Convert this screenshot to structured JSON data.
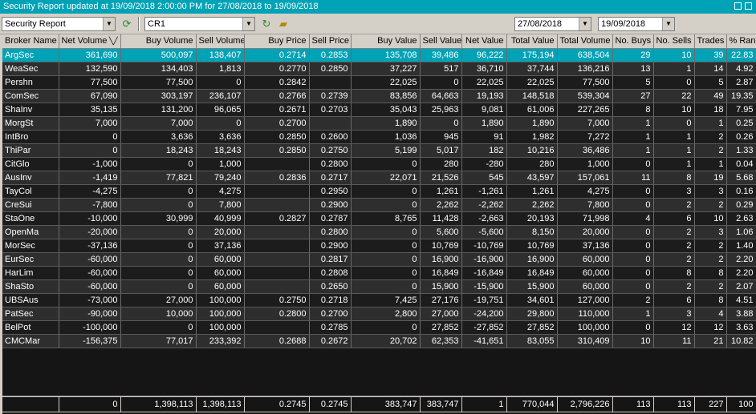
{
  "window": {
    "title": "Security Report updated at 19/09/2018 2:00:00 PM for 27/08/2018 to 19/09/2018"
  },
  "toolbar": {
    "report_select": "Security Report",
    "code_select": "CR1",
    "date_from": "27/08/2018",
    "date_to": "19/09/2018"
  },
  "grid": {
    "columns": [
      "Broker Name",
      "Net Volume",
      "Buy Volume",
      "Sell Volume",
      "Buy Price",
      "Sell Price",
      "Buy Value",
      "Sell Value",
      "Net Value",
      "Total Value",
      "Total Volume",
      "No. Buys",
      "No. Sells",
      "Trades",
      "% Rank"
    ],
    "sort_indicator": "╲╱",
    "rows": [
      [
        "ArgSec",
        "361,690",
        "500,097",
        "138,407",
        "0.2714",
        "0.2853",
        "135,708",
        "39,486",
        "96,222",
        "175,194",
        "638,504",
        "29",
        "10",
        "39",
        "22.83"
      ],
      [
        "WeaSec",
        "132,590",
        "134,403",
        "1,813",
        "0.2770",
        "0.2850",
        "37,227",
        "517",
        "36,710",
        "37,744",
        "136,216",
        "13",
        "1",
        "14",
        "4.92"
      ],
      [
        "Pershn",
        "77,500",
        "77,500",
        "0",
        "0.2842",
        "",
        "22,025",
        "0",
        "22,025",
        "22,025",
        "77,500",
        "5",
        "0",
        "5",
        "2.87"
      ],
      [
        "ComSec",
        "67,090",
        "303,197",
        "236,107",
        "0.2766",
        "0.2739",
        "83,856",
        "64,663",
        "19,193",
        "148,518",
        "539,304",
        "27",
        "22",
        "49",
        "19.35"
      ],
      [
        "ShaInv",
        "35,135",
        "131,200",
        "96,065",
        "0.2671",
        "0.2703",
        "35,043",
        "25,963",
        "9,081",
        "61,006",
        "227,265",
        "8",
        "10",
        "18",
        "7.95"
      ],
      [
        "MorgSt",
        "7,000",
        "7,000",
        "0",
        "0.2700",
        "",
        "1,890",
        "0",
        "1,890",
        "1,890",
        "7,000",
        "1",
        "0",
        "1",
        "0.25"
      ],
      [
        "IntBro",
        "0",
        "3,636",
        "3,636",
        "0.2850",
        "0.2600",
        "1,036",
        "945",
        "91",
        "1,982",
        "7,272",
        "1",
        "1",
        "2",
        "0.26"
      ],
      [
        "ThiPar",
        "0",
        "18,243",
        "18,243",
        "0.2850",
        "0.2750",
        "5,199",
        "5,017",
        "182",
        "10,216",
        "36,486",
        "1",
        "1",
        "2",
        "1.33"
      ],
      [
        "CitGlo",
        "-1,000",
        "0",
        "1,000",
        "",
        "0.2800",
        "0",
        "280",
        "-280",
        "280",
        "1,000",
        "0",
        "1",
        "1",
        "0.04"
      ],
      [
        "AusInv",
        "-1,419",
        "77,821",
        "79,240",
        "0.2836",
        "0.2717",
        "22,071",
        "21,526",
        "545",
        "43,597",
        "157,061",
        "11",
        "8",
        "19",
        "5.68"
      ],
      [
        "TayCol",
        "-4,275",
        "0",
        "4,275",
        "",
        "0.2950",
        "0",
        "1,261",
        "-1,261",
        "1,261",
        "4,275",
        "0",
        "3",
        "3",
        "0.16"
      ],
      [
        "CreSui",
        "-7,800",
        "0",
        "7,800",
        "",
        "0.2900",
        "0",
        "2,262",
        "-2,262",
        "2,262",
        "7,800",
        "0",
        "2",
        "2",
        "0.29"
      ],
      [
        "StaOne",
        "-10,000",
        "30,999",
        "40,999",
        "0.2827",
        "0.2787",
        "8,765",
        "11,428",
        "-2,663",
        "20,193",
        "71,998",
        "4",
        "6",
        "10",
        "2.63"
      ],
      [
        "OpenMa",
        "-20,000",
        "0",
        "20,000",
        "",
        "0.2800",
        "0",
        "5,600",
        "-5,600",
        "8,150",
        "20,000",
        "0",
        "2",
        "3",
        "1.06"
      ],
      [
        "MorSec",
        "-37,136",
        "0",
        "37,136",
        "",
        "0.2900",
        "0",
        "10,769",
        "-10,769",
        "10,769",
        "37,136",
        "0",
        "2",
        "2",
        "1.40"
      ],
      [
        "EurSec",
        "-60,000",
        "0",
        "60,000",
        "",
        "0.2817",
        "0",
        "16,900",
        "-16,900",
        "16,900",
        "60,000",
        "0",
        "2",
        "2",
        "2.20"
      ],
      [
        "HarLim",
        "-60,000",
        "0",
        "60,000",
        "",
        "0.2808",
        "0",
        "16,849",
        "-16,849",
        "16,849",
        "60,000",
        "0",
        "8",
        "8",
        "2.20"
      ],
      [
        "ShaSto",
        "-60,000",
        "0",
        "60,000",
        "",
        "0.2650",
        "0",
        "15,900",
        "-15,900",
        "15,900",
        "60,000",
        "0",
        "2",
        "2",
        "2.07"
      ],
      [
        "UBSAus",
        "-73,000",
        "27,000",
        "100,000",
        "0.2750",
        "0.2718",
        "7,425",
        "27,176",
        "-19,751",
        "34,601",
        "127,000",
        "2",
        "6",
        "8",
        "4.51"
      ],
      [
        "PatSec",
        "-90,000",
        "10,000",
        "100,000",
        "0.2800",
        "0.2700",
        "2,800",
        "27,000",
        "-24,200",
        "29,800",
        "110,000",
        "1",
        "3",
        "4",
        "3.88"
      ],
      [
        "BelPot",
        "-100,000",
        "0",
        "100,000",
        "",
        "0.2785",
        "0",
        "27,852",
        "-27,852",
        "27,852",
        "100,000",
        "0",
        "12",
        "12",
        "3.63"
      ],
      [
        "CMCMar",
        "-156,375",
        "77,017",
        "233,392",
        "0.2688",
        "0.2672",
        "20,702",
        "62,353",
        "-41,651",
        "83,055",
        "310,409",
        "10",
        "11",
        "21",
        "10.82"
      ]
    ],
    "totals": [
      "",
      "0",
      "1,398,113",
      "1,398,113",
      "0.2745",
      "0.2745",
      "383,747",
      "383,747",
      "1",
      "770,044",
      "2,796,226",
      "113",
      "113",
      "227",
      "100"
    ]
  }
}
